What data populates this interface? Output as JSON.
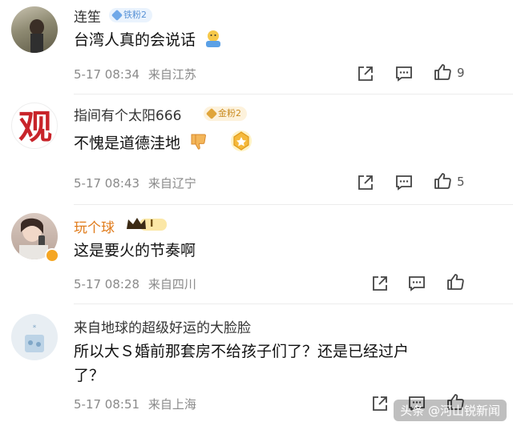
{
  "comments": [
    {
      "username": "连笙",
      "badge": "铁粉2",
      "text": "台湾人真的会说话",
      "time": "5-17 08:34",
      "location": "来自江苏",
      "likes": "9"
    },
    {
      "username": "指间有个太阳666",
      "badge": "金粉2",
      "avatar_char": "观",
      "text": "不愧是道德洼地",
      "time": "5-17 08:43",
      "location": "来自辽宁",
      "likes": "5"
    },
    {
      "username": "玩个球",
      "badge": "I",
      "text": "这是要火的节奏啊",
      "time": "5-17 08:28",
      "location": "来自四川",
      "likes": ""
    },
    {
      "username": "来自地球的超级好运的大脸脸",
      "text_line1": "所以大Ｓ婚前那套房不给孩子们了？还是已经过户",
      "text_line2": "了？",
      "time": "5-17 08:51",
      "location": "来自上海",
      "likes": ""
    }
  ],
  "watermark": "头条 @河山锐新闻",
  "colors": {
    "tie_badge": "#6fa8e8",
    "gold_badge": "#e0a53a",
    "username_gold": "#e07b1a",
    "meta_gray": "#8a8a8a"
  }
}
